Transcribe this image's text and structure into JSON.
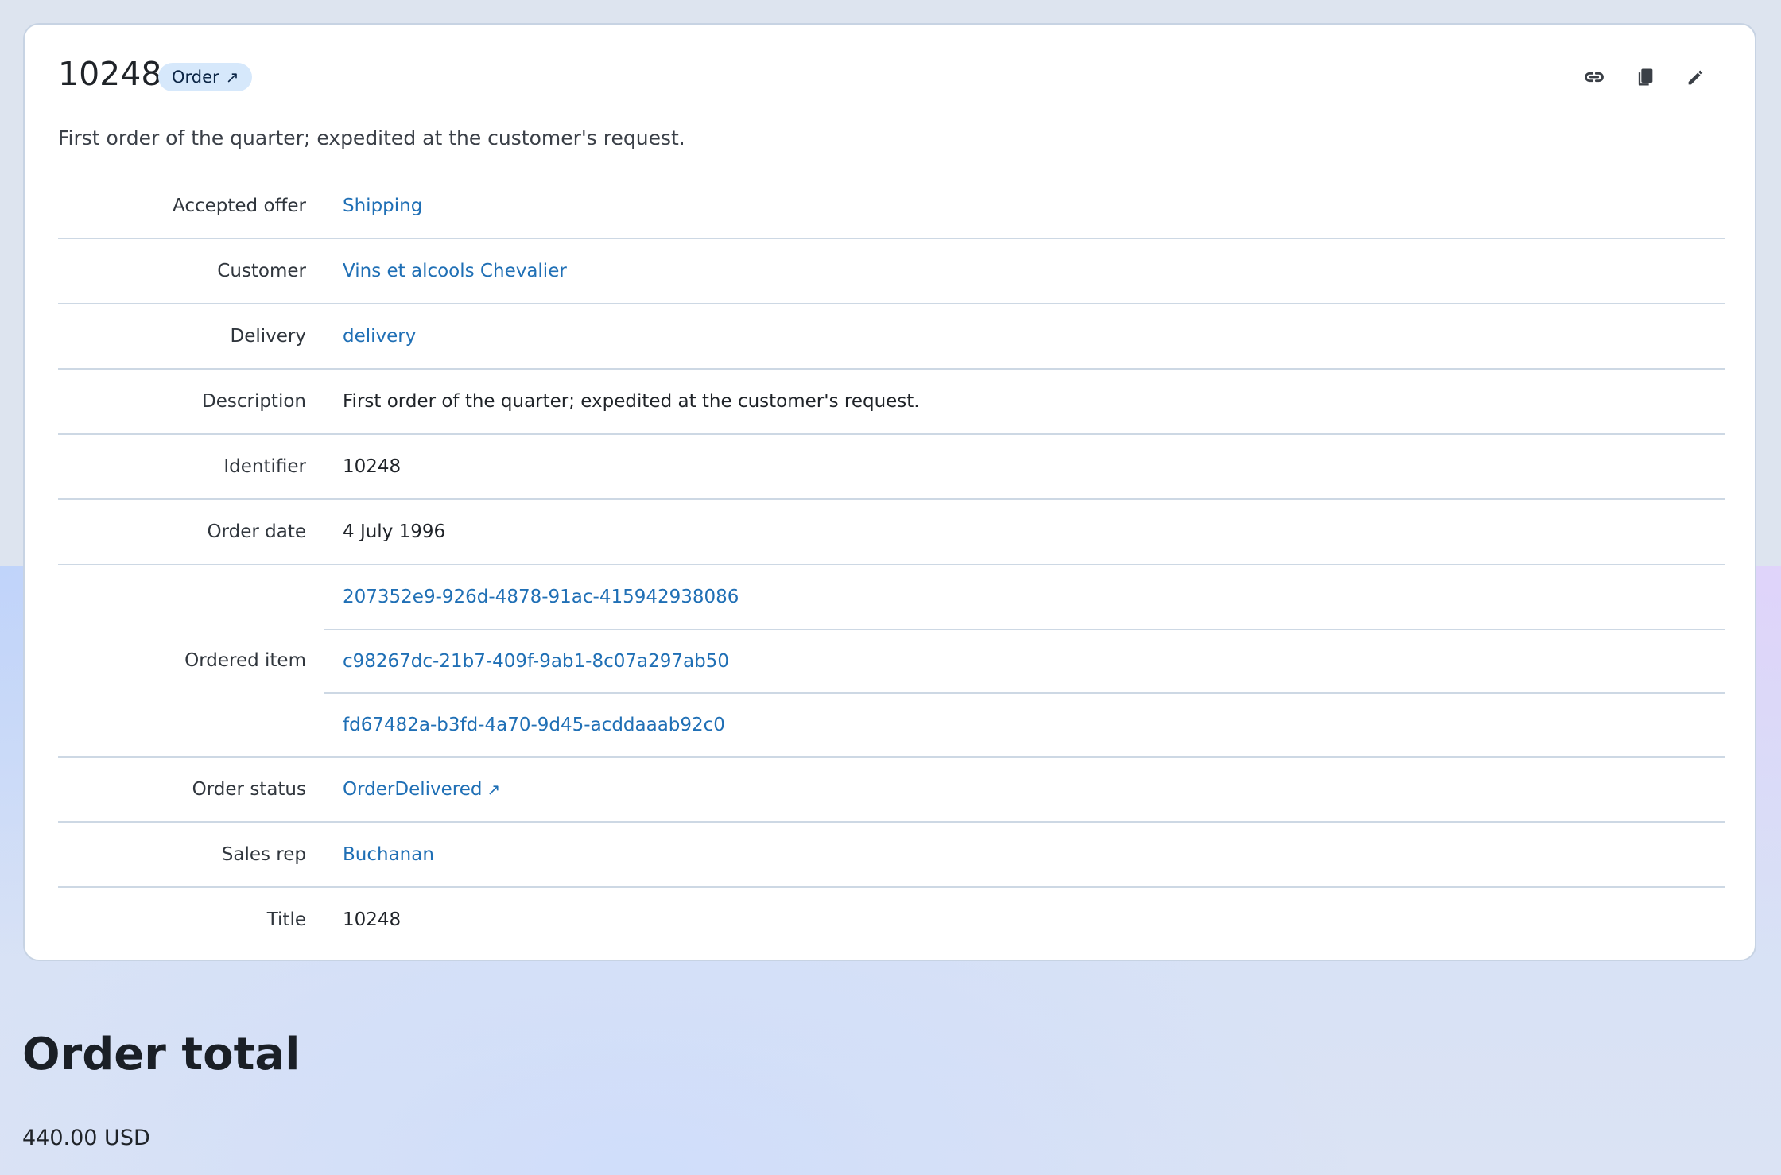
{
  "record": {
    "title": "10248",
    "type_badge": "Order",
    "type_badge_arrow": "↗",
    "subtitle": "First order of the quarter; expedited at the customer's request."
  },
  "actions": [
    {
      "name": "copy-link",
      "icon": "link-icon"
    },
    {
      "name": "duplicate",
      "icon": "copy-icon"
    },
    {
      "name": "edit",
      "icon": "pencil-icon"
    }
  ],
  "properties": {
    "accepted_offer": {
      "label": "Accepted offer",
      "value": "Shipping"
    },
    "customer": {
      "label": "Customer",
      "value": "Vins et alcools Chevalier"
    },
    "delivery": {
      "label": "Delivery",
      "value": "delivery"
    },
    "description": {
      "label": "Description",
      "value": "First order of the quarter; expedited at the customer's request."
    },
    "identifier": {
      "label": "Identifier",
      "value": "10248"
    },
    "order_date": {
      "label": "Order date",
      "value": "4 July 1996"
    },
    "ordered_item": {
      "label": "Ordered item",
      "values": [
        "207352e9-926d-4878-91ac-415942938086",
        "c98267dc-21b7-409f-9ab1-8c07a297ab50",
        "fd67482a-b3fd-4a70-9d45-acddaaab92c0"
      ]
    },
    "order_status": {
      "label": "Order status",
      "value": "OrderDelivered",
      "arrow": "↗"
    },
    "sales_rep": {
      "label": "Sales rep",
      "value": "Buchanan"
    },
    "title": {
      "label": "Title",
      "value": "10248"
    }
  },
  "order_total": {
    "heading": "Order total",
    "value": "440.00 USD"
  },
  "colors": {
    "link": "#1f6fb5",
    "badge_bg": "#d6e8fb",
    "border": "#cdd8e4"
  }
}
